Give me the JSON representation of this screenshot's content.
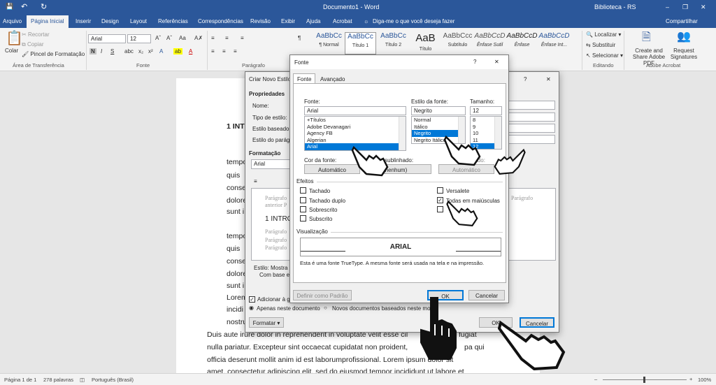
{
  "titlebar": {
    "doc_title": "Documento1 - Word",
    "right_title": "Biblioteca - RS",
    "minimize": "–",
    "restore": "❐",
    "close": "✕",
    "quick_save": "💾",
    "undo": "↶",
    "redo": "↻"
  },
  "tabs": [
    "Arquivo",
    "Página Inicial",
    "Inserir",
    "Design",
    "Layout",
    "Referências",
    "Correspondências",
    "Revisão",
    "Exibir",
    "Ajuda",
    "Acrobat"
  ],
  "tell_me": "Diga-me o que você deseja fazer",
  "share": "Compartilhar",
  "ribbon": {
    "paste": "Colar",
    "cut": "Recortar",
    "copy": "Copiar",
    "format_painter": "Pincel de Formatação",
    "clipboard_group": "Área de Transferência",
    "font_name": "Arial",
    "font_size": "12",
    "font_group": "Fonte",
    "paragraph_group": "Parágrafo",
    "styles": [
      {
        "preview": "AaBbCc",
        "name": "¶ Normal"
      },
      {
        "preview": "AaBbCc",
        "name": "Título 1"
      },
      {
        "preview": "AaBbCc",
        "name": "Título 2"
      },
      {
        "preview": "AaB",
        "name": "Título"
      },
      {
        "preview": "AaBbCcc",
        "name": "Subtítulo"
      },
      {
        "preview": "AaBbCcD",
        "name": "Ênfase Sutil"
      },
      {
        "preview": "AaBbCcD",
        "name": "Ênfase"
      },
      {
        "preview": "AaBbCcD",
        "name": "Ênfase Int..."
      }
    ],
    "find": "Localizar",
    "replace": "Substituir",
    "select": "Selecionar",
    "editing_group": "Editando",
    "create_pdf": "Create and Share Adobe PDF",
    "request_sig": "Request Signatures",
    "acrobat_group": "Adobe Acrobat"
  },
  "document": {
    "heading": "1 INTR",
    "left_lines": [
      "tempo",
      "quis",
      "conse",
      "dolore",
      "sunt i",
      "tempo",
      "quis",
      "conse",
      "dolore",
      "sunt i",
      "Lorem",
      "incidi",
      "nostru"
    ],
    "full_lines": [
      "Duis aute irure dolor in reprehenderit in voluptate velit esse cil",
      "fugiat",
      "nulla pariatur. Excepteur sint occaecat cupidatat non proident,",
      "pa qui",
      "officia deserunt mollit anim id est laborumprofissional. Lorem ipsum dolor sit",
      "amet, consectetur adipiscing elit, sed do eiusmod tempor incididunt ut labore et"
    ]
  },
  "status": {
    "page": "Página 1 de 1",
    "words": "278 palavras",
    "lang": "Português (Brasil)",
    "zoom": "100%"
  },
  "style_dialog": {
    "title": "Criar Novo Estilo",
    "properties": "Propriedades",
    "name": "Nome:",
    "style_type": "Tipo de estilo:",
    "based_on": "Estilo baseado",
    "next_style": "Estilo do parág",
    "formatting": "Formatação",
    "font_value": "Arial",
    "preview_lines": [
      "Parágrafo",
      "anterior P",
      "1 INTRO",
      "Parágrafo",
      "Parágrafo",
      "Parágrafo"
    ],
    "right_preview": "Parágrafo",
    "desc": "Estilo: Mostra",
    "desc2": "Com base e",
    "add_gallery": "Adicionar à g",
    "only_doc": "Apenas neste documento",
    "new_docs": "Novos documentos baseados neste mo",
    "format_btn": "Formatar ▾",
    "ok": "OK",
    "cancel": "Cancelar",
    "help": "?",
    "close": "✕"
  },
  "font_dialog": {
    "title": "Fonte",
    "help": "?",
    "close": "✕",
    "tab_font": "Fonte",
    "tab_advanced": "Avançado",
    "font_label": "Fonte:",
    "font_value": "Arial",
    "font_list": [
      "+Títulos",
      "Adobe Devanagari",
      "Agency FB",
      "Algerian",
      "Arial"
    ],
    "style_label": "Estilo da fonte:",
    "style_value": "Negrito",
    "style_list": [
      "Normal",
      "Itálico",
      "Negrito",
      "Negrito Itálico"
    ],
    "size_label": "Tamanho:",
    "size_value": "12",
    "size_list": [
      "8",
      "9",
      "10",
      "11",
      "12"
    ],
    "color_label": "Cor da fonte:",
    "color_value": "Automático",
    "underline_label": "de sublinhado:",
    "underline_value": "(nenhum)",
    "underline_color_label": "sublinhado:",
    "underline_color_value": "Automático",
    "effects": "Efeitos",
    "effects_left": [
      "Tachado",
      "Tachado duplo",
      "Sobrescrito",
      "Subscrito"
    ],
    "effects_right": [
      "Versalete",
      "Todas em maiúsculas",
      ""
    ],
    "preview_label": "Visualização",
    "preview_text": "ARIAL",
    "note": "Esta é uma fonte TrueType. A mesma fonte será usada na tela e na impressão.",
    "default_btn": "Definir como Padrão",
    "ok": "OK",
    "cancel": "Cancelar"
  }
}
